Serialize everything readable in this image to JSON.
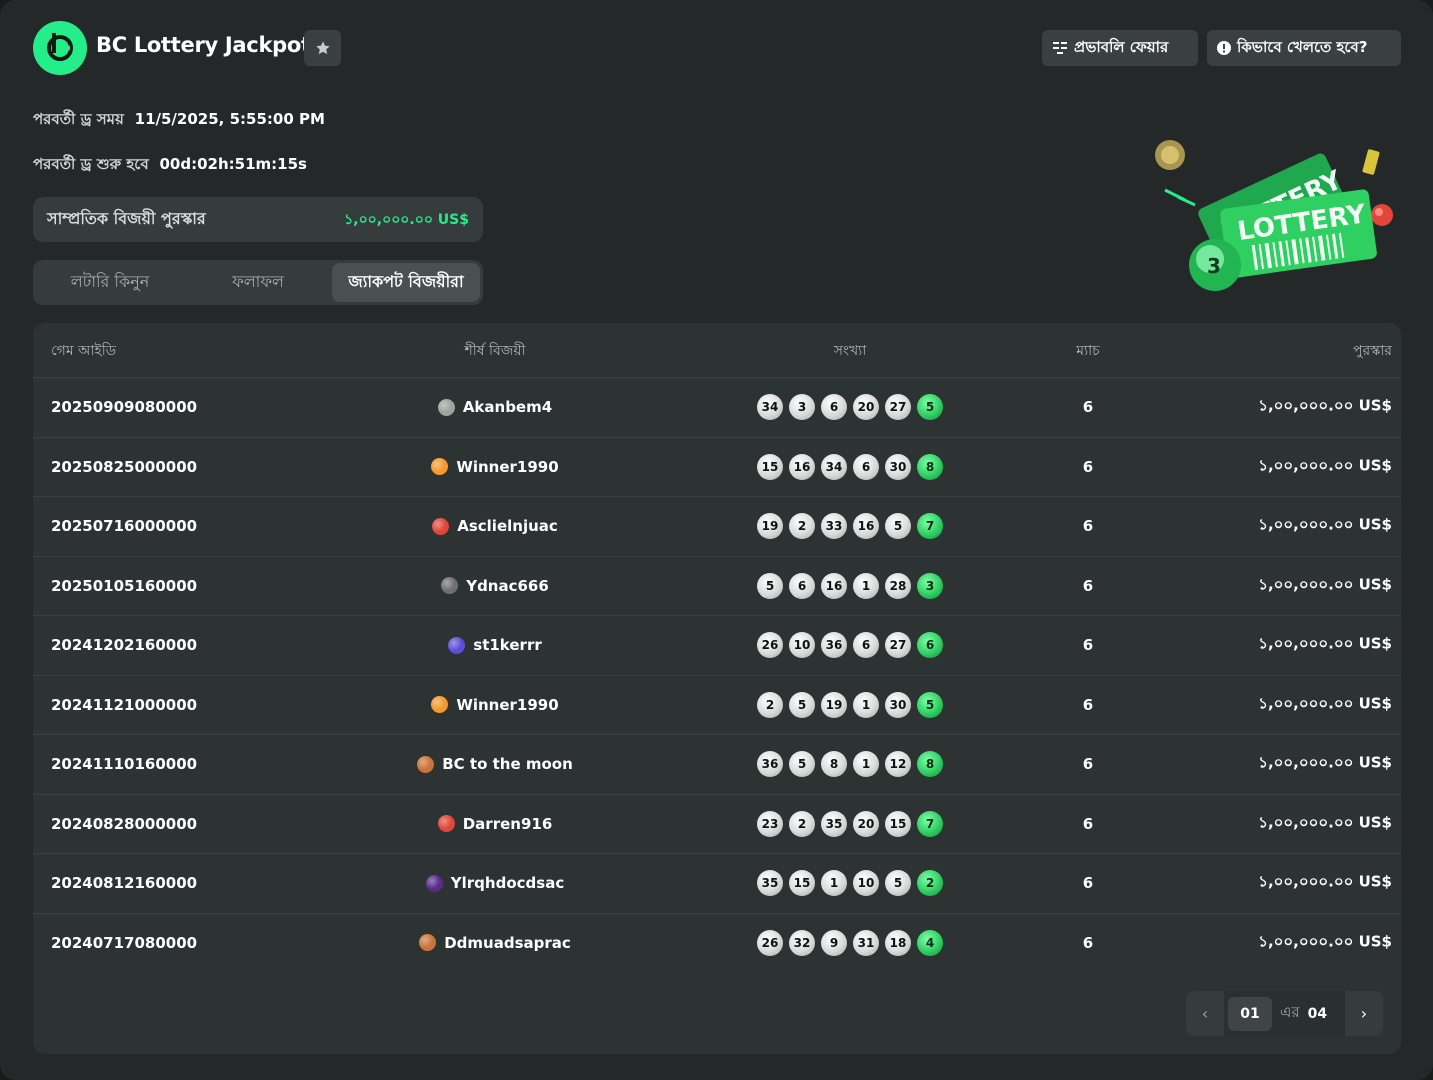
{
  "header": {
    "title": "BC Lottery Jackpot",
    "fair_label": "প্রভাবলি ফেয়ার",
    "how_label": "কিভাবে খেলতে হবে?"
  },
  "info": {
    "next_draw_label": "পরবর্তী ড্র সময়",
    "next_draw_value": "11/5/2025, 5:55:00 PM",
    "starts_label": "পরবর্তী ড্র শুরু হবে",
    "starts_value": "00d:02h:51m:15s"
  },
  "prize": {
    "label": "সাম্প্রতিক বিজয়ী পুরস্কার",
    "value": "১,০০,০০০.০০ US$"
  },
  "tabs": [
    {
      "label": "লটারি কিনুন",
      "active": false
    },
    {
      "label": "ফলাফল",
      "active": false
    },
    {
      "label": "জ্যাকপট বিজয়ীরা",
      "active": true
    }
  ],
  "illustration": {
    "ticket_text_1": "LOTTERY",
    "ticket_text_2": "LOTTERY",
    "ball_number": "3"
  },
  "table": {
    "headers": {
      "id": "গেম আইডি",
      "winner": "শীর্ষ বিজয়ী",
      "numbers": "সংখ্যা",
      "match": "ম্যাচ",
      "prize": "পুরস্কার"
    },
    "rows": [
      {
        "id": "20250909080000",
        "winner": "Akanbem4",
        "avatar_color": "#9aa39c",
        "numbers": [
          "34",
          "3",
          "6",
          "20",
          "27"
        ],
        "bonus": "5",
        "match": "6",
        "prize": "১,০০,০০০.০০ US$"
      },
      {
        "id": "20250825000000",
        "winner": "Winner1990",
        "avatar_color": "#f29a2e",
        "numbers": [
          "15",
          "16",
          "34",
          "6",
          "30"
        ],
        "bonus": "8",
        "match": "6",
        "prize": "১,০০,০০০.০০ US$"
      },
      {
        "id": "20250716000000",
        "winner": "Asclielnjuac",
        "avatar_color": "#e0463a",
        "numbers": [
          "19",
          "2",
          "33",
          "16",
          "5"
        ],
        "bonus": "7",
        "match": "6",
        "prize": "১,০০,০০০.০০ US$"
      },
      {
        "id": "20250105160000",
        "winner": "Ydnac666",
        "avatar_color": "#6f6f6f",
        "numbers": [
          "5",
          "6",
          "16",
          "1",
          "28"
        ],
        "bonus": "3",
        "match": "6",
        "prize": "১,০০,০০০.০০ US$"
      },
      {
        "id": "20241202160000",
        "winner": "st1kerrr",
        "avatar_color": "#5b4fd6",
        "numbers": [
          "26",
          "10",
          "36",
          "6",
          "27"
        ],
        "bonus": "6",
        "match": "6",
        "prize": "১,০০,০০০.০০ US$"
      },
      {
        "id": "20241121000000",
        "winner": "Winner1990",
        "avatar_color": "#f29a2e",
        "numbers": [
          "2",
          "5",
          "19",
          "1",
          "30"
        ],
        "bonus": "5",
        "match": "6",
        "prize": "১,০০,০০০.০০ US$"
      },
      {
        "id": "20241110160000",
        "winner": "BC to the moon",
        "avatar_color": "#c9733a",
        "numbers": [
          "36",
          "5",
          "8",
          "1",
          "12"
        ],
        "bonus": "8",
        "match": "6",
        "prize": "১,০০,০০০.০০ US$"
      },
      {
        "id": "20240828000000",
        "winner": "Darren916",
        "avatar_color": "#e0463a",
        "numbers": [
          "23",
          "2",
          "35",
          "20",
          "15"
        ],
        "bonus": "7",
        "match": "6",
        "prize": "১,০০,০০০.০০ US$"
      },
      {
        "id": "20240812160000",
        "winner": "Ylrqhdocdsac",
        "avatar_color": "#5a2c8a",
        "numbers": [
          "35",
          "15",
          "1",
          "10",
          "5"
        ],
        "bonus": "2",
        "match": "6",
        "prize": "১,০০,০০০.০০ US$"
      },
      {
        "id": "20240717080000",
        "winner": "Ddmuadsaprac",
        "avatar_color": "#c9733a",
        "numbers": [
          "26",
          "32",
          "9",
          "31",
          "18"
        ],
        "bonus": "4",
        "match": "6",
        "prize": "১,০০,০০০.০০ US$"
      }
    ]
  },
  "pagination": {
    "current": "01",
    "of_label": "এর",
    "total": "04"
  },
  "colors": {
    "accent": "#24ee89",
    "background": "#242828",
    "panel": "#2d3232"
  }
}
